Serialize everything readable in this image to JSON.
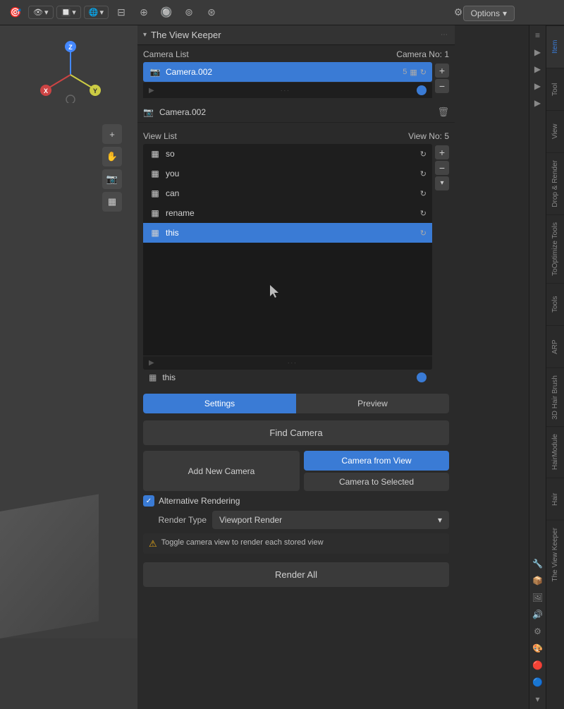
{
  "toolbar": {
    "options_label": "Options",
    "options_chevron": "▾"
  },
  "panel": {
    "title": "The View Keeper",
    "collapse_icon": "▾",
    "dots": "⋯"
  },
  "camera_list": {
    "label": "Camera List",
    "camera_no_label": "Camera No:",
    "camera_no_value": "1",
    "items": [
      {
        "name": "Camera.002",
        "badge": "5",
        "selected": true
      }
    ],
    "add_icon": "+",
    "remove_icon": "−",
    "scroll_arrow": "▶",
    "scroll_dots": "···",
    "single_camera_name": "Camera.002",
    "trash_icon": "🗑"
  },
  "view_list": {
    "label": "View List",
    "view_no_label": "View No:",
    "view_no_value": "5",
    "items": [
      {
        "name": "so",
        "selected": false
      },
      {
        "name": "you",
        "selected": false
      },
      {
        "name": "can",
        "selected": false
      },
      {
        "name": "rename",
        "selected": false
      },
      {
        "name": "this",
        "selected": true
      }
    ],
    "add_icon": "+",
    "remove_icon": "−",
    "scroll_arrow": "▶",
    "scroll_dots": "···",
    "current_view_name": "this"
  },
  "tabs": {
    "settings_label": "Settings",
    "preview_label": "Preview"
  },
  "buttons": {
    "find_camera": "Find Camera",
    "add_new_camera": "Add New Camera",
    "camera_from_view": "Camera from View",
    "camera_to_selected": "Camera to Selected",
    "render_all": "Render All"
  },
  "alt_rendering": {
    "label": "Alternative Rendering",
    "checked": true
  },
  "render_type": {
    "label": "Render Type",
    "value": "Viewport Render",
    "chevron": "▾"
  },
  "warning": {
    "icon": "⚠",
    "text": "Toggle camera view to render each stored view"
  },
  "right_tabs": {
    "items": [
      "Item",
      "Tool",
      "View",
      "Drop & Render",
      "ToOptimize Tools",
      "Tools",
      "ARP",
      "3D Hair Brush",
      "HairModule",
      "Hair",
      "The View Keeper"
    ]
  },
  "icons": {
    "camera": "📷",
    "grid": "▦",
    "refresh": "↻",
    "plus": "+",
    "minus": "−",
    "trash": "🗑",
    "warning": "⚠",
    "chevron_down": "▾",
    "play": "▶",
    "zoom_in": "+",
    "hand": "✋",
    "crosshair": "⊕",
    "grid2": "⊞"
  },
  "axis": {
    "x_label": "X",
    "y_label": "Y",
    "z_label": "Z"
  }
}
